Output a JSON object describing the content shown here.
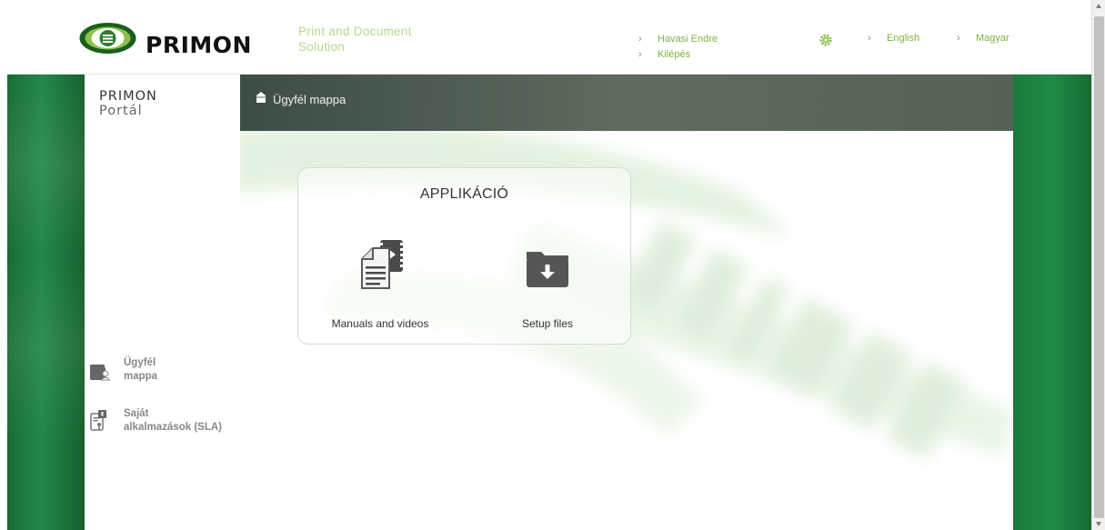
{
  "header": {
    "logo_text": "PRIMON",
    "tagline_line1": "Print and Document",
    "tagline_line2": "Solution",
    "user_name": "Havasi Endre",
    "logout": "Kilépés",
    "lang_english": "English",
    "lang_hungarian": "Magyar",
    "chevron": "›"
  },
  "sidebar": {
    "portal_title_line1": "PRIMON",
    "portal_title_line2": "Portál",
    "items": [
      {
        "line1": "Ügyfél",
        "line2": "mappa",
        "icon": "folder-user-icon"
      },
      {
        "line1": "Saját",
        "line2": "alkalmazások (SLA)",
        "icon": "app-document-icon"
      }
    ]
  },
  "breadcrumb": {
    "label": "Ügyfél mappa",
    "icon": "home-icon"
  },
  "app_card": {
    "title": "APPLIKÁCIÓ",
    "tiles": [
      {
        "label": "Manuals and videos",
        "icon": "documents-video-icon"
      },
      {
        "label": "Setup files",
        "icon": "download-folder-icon"
      }
    ]
  },
  "colors": {
    "brand_green": "#1f8a47",
    "link_green": "#7cb342",
    "tagline_green": "#b8d88d",
    "breadcrumb_bg": "#4f5e54",
    "icon_gray": "#555555"
  }
}
